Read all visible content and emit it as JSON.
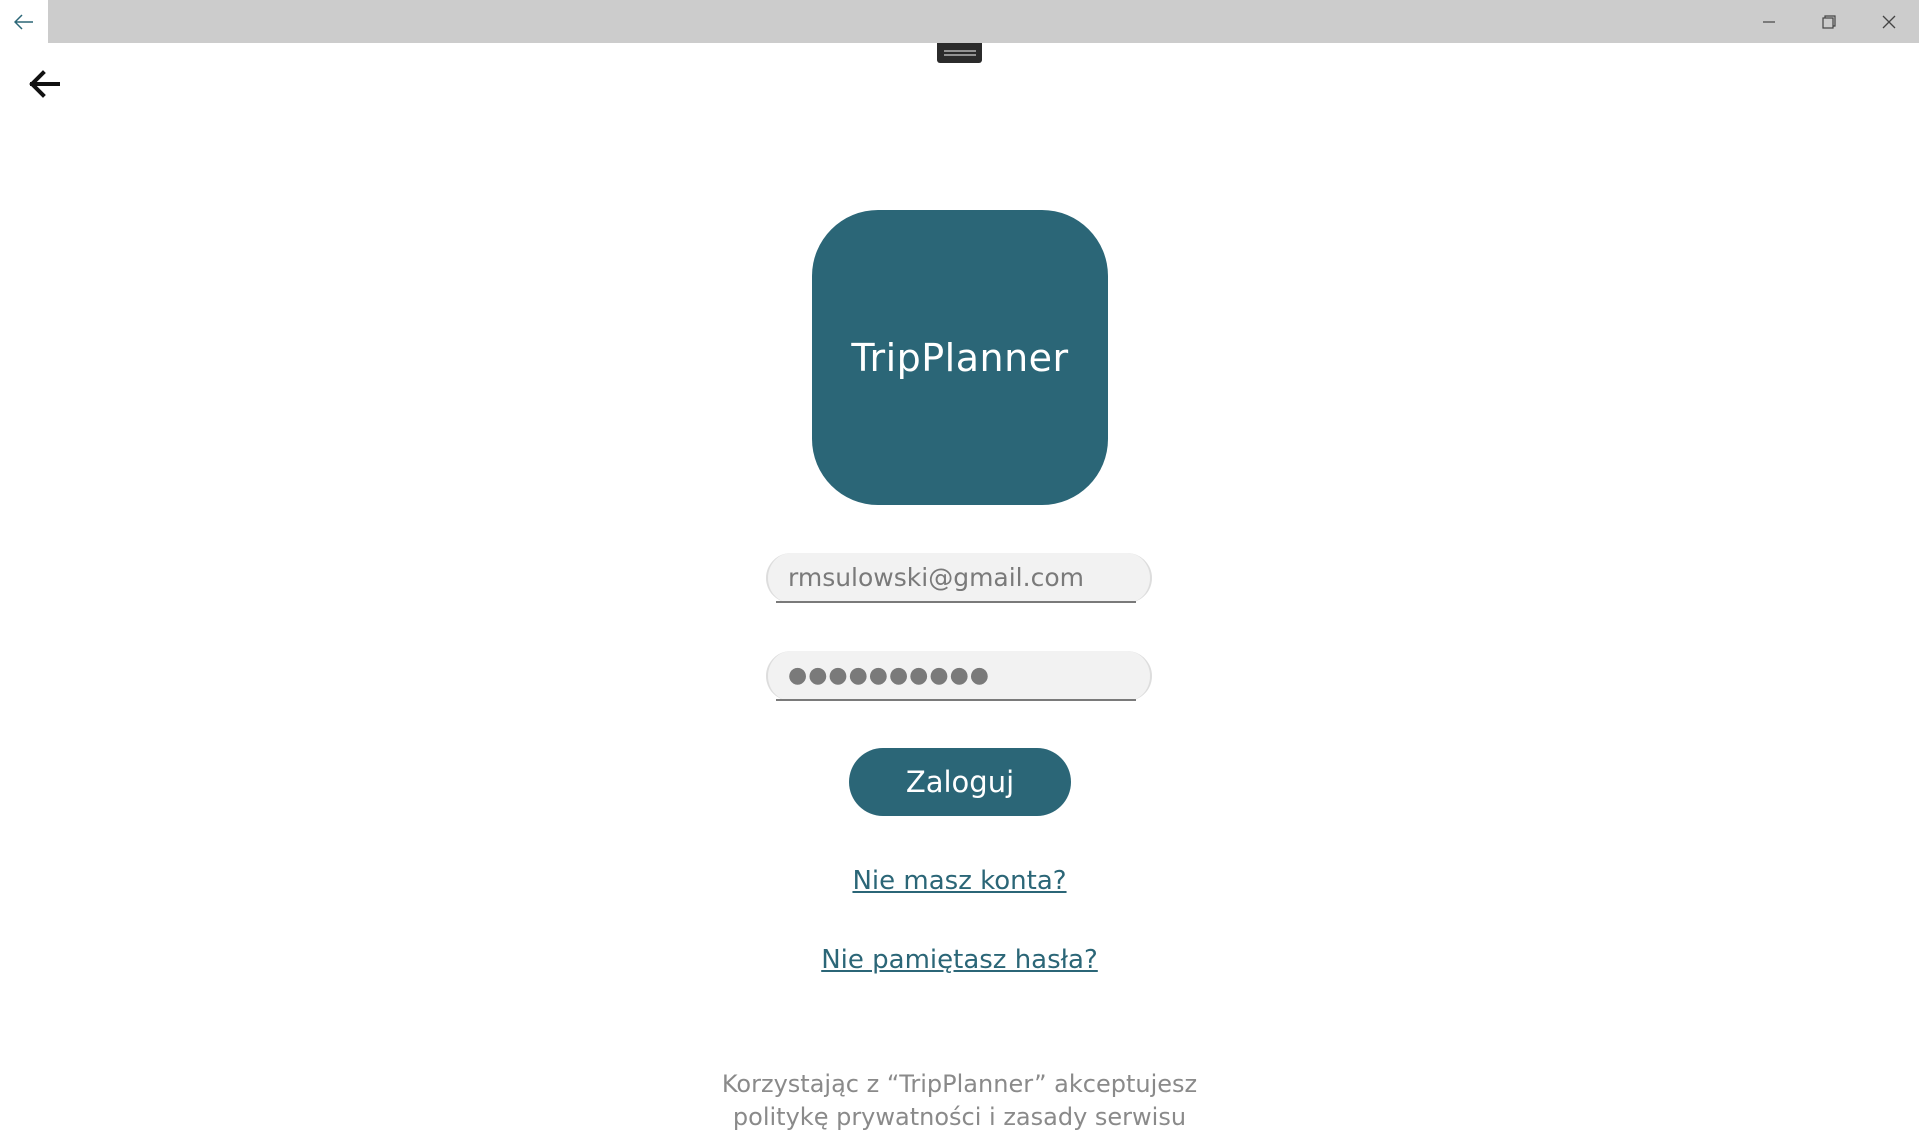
{
  "window": {
    "titlebar_back_icon": "back-arrow-icon",
    "minimize_icon": "minimize-icon",
    "maximize_icon": "restore-icon",
    "close_icon": "close-icon"
  },
  "page": {
    "back_icon": "back-arrow-icon"
  },
  "logo": {
    "text": "TripPlanner",
    "color": "#2b6677"
  },
  "login_form": {
    "email_value": "rmsulowski@gmail.com",
    "password_value": "●●●●●●●●●●",
    "submit_label": "Zaloguj"
  },
  "links": {
    "register": "Nie masz konta?",
    "forgot_password": "Nie pamiętasz hasła?"
  },
  "footer": {
    "line1": "Korzystając z “TripPlanner” akceptujesz",
    "line2": "politykę prywatności i zasady serwisu"
  },
  "colors": {
    "accent": "#2b6677",
    "titlebar": "#cccccc",
    "muted_text": "#8a8a8a"
  }
}
